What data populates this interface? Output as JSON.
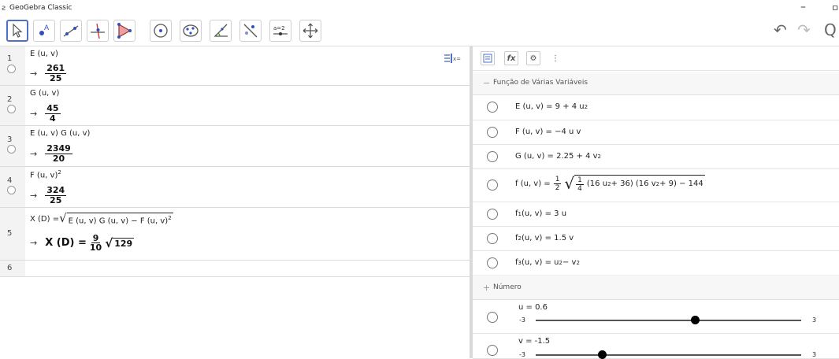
{
  "titlebar": {
    "title": "GeoGebra Classic",
    "app_icon": "ƨ",
    "minimize": "–",
    "maximize": "ㅁ"
  },
  "toolbar": {
    "tools": [
      "move-tool",
      "point-tool",
      "line-tool",
      "perpendicular-line-tool",
      "polygon-tool",
      "circle-center-tool",
      "conic-tool",
      "angle-tool",
      "reflect-tool",
      "slider-tool",
      "move-graphics-tool"
    ],
    "slider_label": "a=2",
    "undo_glyph": "↶",
    "redo_glyph": "↷",
    "search_glyph": "Q"
  },
  "cas": {
    "rows": [
      {
        "num": "1",
        "input": "E (u, v)",
        "out_num": "261",
        "out_den": "25"
      },
      {
        "num": "2",
        "input": "G (u, v)",
        "out_num": "45",
        "out_den": "4"
      },
      {
        "num": "3",
        "input": "E (u, v)  G (u, v)",
        "out_num": "2349",
        "out_den": "20"
      },
      {
        "num": "4",
        "input_base": "F (u, v)",
        "input_exp": "2",
        "out_num": "324",
        "out_den": "25"
      },
      {
        "num": "5",
        "input_lhs": "X (D) = ",
        "input_rad": "E (u, v)  G (u, v) − F (u, v)",
        "input_rad_exp": "2",
        "out_lhs": "X (D) = ",
        "out_num": "9",
        "out_den": "10",
        "out_rad": "129"
      },
      {
        "num": "6"
      }
    ],
    "arrow": "→",
    "toggle_label": "x="
  },
  "algebra": {
    "header_icons": [
      "algebra-view-icon",
      "fx-icon",
      "gear-icon",
      "more-icon"
    ],
    "fx_label": "fx",
    "gear": "⚙",
    "more": "⋮",
    "group1": {
      "toggle": "−",
      "title": "Função de Várias Variáveis"
    },
    "functions": {
      "E": {
        "lhs": "E (u, v)  =  9 + 4 u",
        "exp": "2"
      },
      "F": {
        "lhs": "F (u, v)  =  −4 u v"
      },
      "G": {
        "lhs": "G (u, v)  =  2.25 + 4 v",
        "exp": "2"
      },
      "f": {
        "lhs": "f (u, v)  = ",
        "half_num": "1",
        "half_den": "2",
        "q_num": "1",
        "q_den": "4",
        "body_a": "(16 u",
        "body_b": " + 36)  (16 v",
        "body_c": " + 9) − 144",
        "exp": "2"
      },
      "f1": {
        "name": "f",
        "sub": "1",
        "rhs": " (u, v)  =  3 u"
      },
      "f2": {
        "name": "f",
        "sub": "2",
        "rhs": " (u, v)  =  1.5 v"
      },
      "f3": {
        "name": "f",
        "sub": "3",
        "rhs_a": " (u, v)  =  u",
        "rhs_b": " − v",
        "exp": "2"
      }
    },
    "group2": {
      "toggle": "+",
      "title": "Número"
    },
    "sliders": [
      {
        "label": "u = 0.6",
        "min": "-3",
        "max": "3",
        "value": 0.6
      },
      {
        "label": "v = -1.5",
        "min": "-3",
        "max": "3",
        "value": -1.5
      }
    ]
  }
}
